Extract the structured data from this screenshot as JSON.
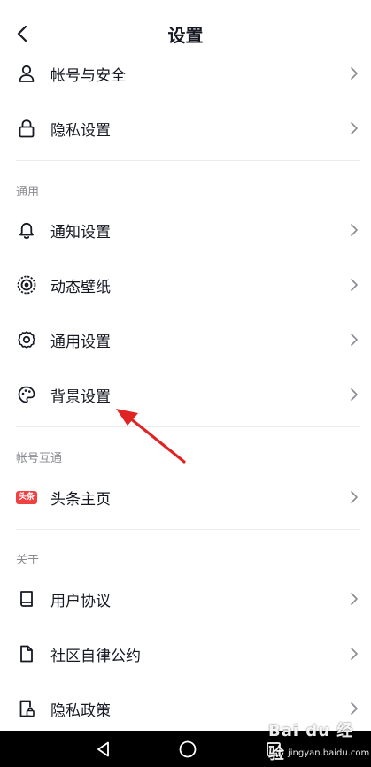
{
  "header": {
    "title": "设置"
  },
  "account_rows": [
    {
      "label": "帐号与安全",
      "icon": "user-icon"
    },
    {
      "label": "隐私设置",
      "icon": "lock-icon"
    }
  ],
  "general": {
    "section_title": "通用",
    "rows": [
      {
        "label": "通知设置",
        "icon": "bell-icon"
      },
      {
        "label": "动态壁纸",
        "icon": "live-wallpaper-icon"
      },
      {
        "label": "通用设置",
        "icon": "gear-icon"
      },
      {
        "label": "背景设置",
        "icon": "palette-icon"
      }
    ]
  },
  "linked": {
    "section_title": "帐号互通",
    "rows": [
      {
        "label": "头条主页",
        "icon": "toutiao-badge-icon",
        "badge_text": "头条"
      }
    ]
  },
  "about": {
    "section_title": "关于",
    "rows": [
      {
        "label": "用户协议",
        "icon": "book-icon"
      },
      {
        "label": "社区自律公约",
        "icon": "document-icon"
      },
      {
        "label": "隐私政策",
        "icon": "privacy-doc-icon"
      }
    ]
  },
  "watermark": {
    "brand": "Bai du 经验",
    "url": "jingyan.baidu.com"
  },
  "colors": {
    "text": "#161823",
    "secondary": "#8a8b91",
    "arrow": "#e02424",
    "badge": "#f04142"
  }
}
